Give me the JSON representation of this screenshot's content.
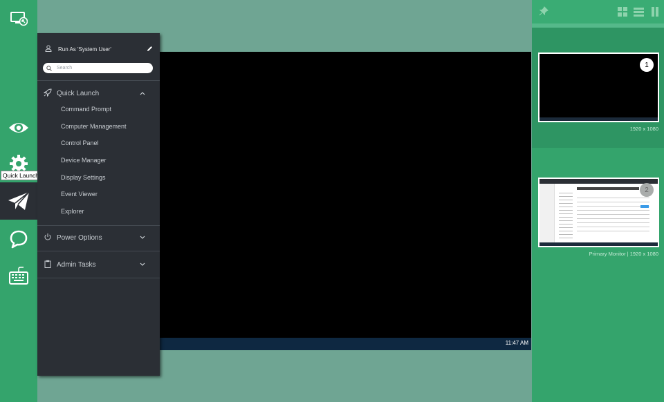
{
  "rail": {
    "tooltip": "Quick Launch",
    "icons": [
      "remote-screen-icon",
      "eye-icon",
      "gear-icon",
      "paper-plane-icon",
      "chat-icon",
      "keyboard-icon"
    ]
  },
  "panel": {
    "run_as": "Run As 'System User'",
    "search_placeholder": "Search",
    "quick_launch": {
      "label": "Quick Launch",
      "items": [
        "Command Prompt",
        "Computer Management",
        "Control Panel",
        "Device Manager",
        "Display Settings",
        "Event Viewer",
        "Explorer"
      ]
    },
    "power_options": {
      "label": "Power Options"
    },
    "admin_tasks": {
      "label": "Admin Tasks"
    }
  },
  "screen": {
    "clock": "11:47 AM"
  },
  "monitors": [
    {
      "number": "1",
      "caption": "1920 x 1080"
    },
    {
      "number": "2",
      "caption": "Primary Monitor | 1920 x 1080"
    }
  ],
  "colors": {
    "rail": "#34a46c",
    "panel": "#2b2f35",
    "background": "#6fa593"
  }
}
